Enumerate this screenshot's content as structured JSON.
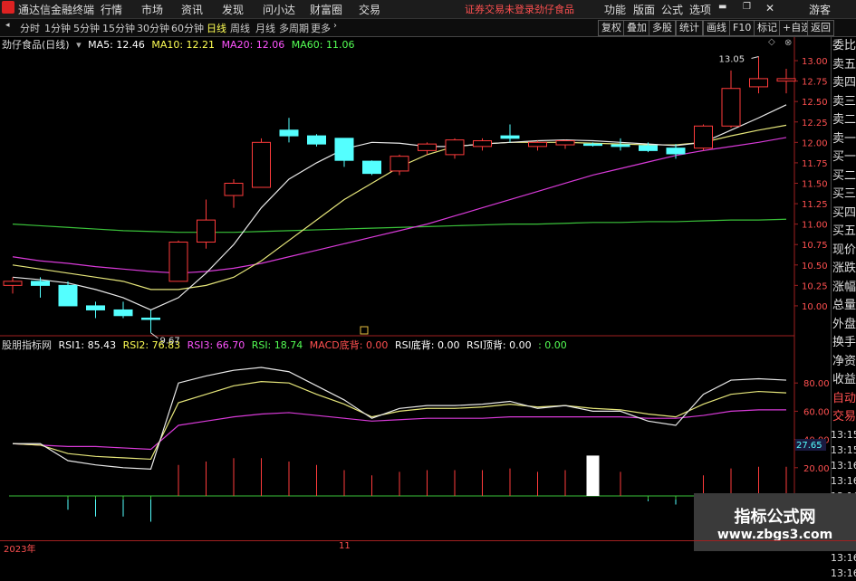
{
  "titlebar": {
    "app_title": "通达信金融终端",
    "menus": [
      "行情",
      "市场",
      "资讯",
      "发现",
      "问小达",
      "财富圈",
      "交易"
    ],
    "notice": "证券交易未登录",
    "stock": "劲仔食品",
    "right_menus": [
      "功能",
      "版面",
      "公式",
      "选项"
    ],
    "user": "游客"
  },
  "toolbar": {
    "periods": [
      "分时",
      "1分钟",
      "5分钟",
      "15分钟",
      "30分钟",
      "60分钟",
      "日线",
      "周线",
      "月线",
      "多周期",
      "更多"
    ],
    "active": "日线",
    "right_buttons": [
      "复权",
      "叠加",
      "多股",
      "统计",
      "画线",
      "F10",
      "标记",
      "+自选",
      "返回"
    ]
  },
  "main_chart": {
    "stock_title": "劲仔食品(日线)",
    "ma": [
      {
        "label": "MA5: 12.46",
        "color": "#ffffff"
      },
      {
        "label": "MA10: 12.21",
        "color": "#ffff54"
      },
      {
        "label": "MA20: 12.06",
        "color": "#ff54ff"
      },
      {
        "label": "MA60: 11.06",
        "color": "#54ff54"
      }
    ],
    "high_label": "13.05",
    "low_label": "9.67",
    "price_ticks": [
      "13.00",
      "12.75",
      "12.50",
      "12.25",
      "12.00",
      "11.75",
      "11.50",
      "11.25",
      "11.00",
      "10.75",
      "10.50",
      "10.25",
      "10.00"
    ]
  },
  "indicator": {
    "name": "股朋指标网",
    "items": [
      {
        "label": "RSI1: 85.43",
        "color": "#ffffff"
      },
      {
        "label": "RSI2: 76.83",
        "color": "#ffff54"
      },
      {
        "label": "RSI3: 66.70",
        "color": "#ff54ff"
      },
      {
        "label": "RSI: 18.74",
        "color": "#54ff54"
      },
      {
        "label": "MACD底背: 0.00",
        "color": "#ff5050"
      },
      {
        "label": "RSI底背: 0.00",
        "color": "#ffffff"
      },
      {
        "label": "RSI顶背: 0.00",
        "color": "#ffffff"
      },
      {
        "label": ": 0.00",
        "color": "#54ff54"
      }
    ],
    "ticks": [
      "80.00",
      "60.00",
      "40.00",
      "20.00"
    ],
    "current": "27.65"
  },
  "side_panel": [
    "委比",
    "卖五",
    "卖四",
    "卖三",
    "卖二",
    "卖一",
    "买一",
    "买二",
    "买三",
    "买四",
    "买五",
    "现价",
    "涨跌",
    "涨幅",
    "总量",
    "外盘",
    "换手",
    "净资",
    "收益"
  ],
  "side_lower": [
    "自动",
    "交易"
  ],
  "times": [
    "13:15",
    "13:15",
    "13:16",
    "13:16",
    "13:16",
    "13:16",
    "13:16",
    "13:16",
    "13:16",
    "13:16"
  ],
  "bottom": {
    "year": "2023年",
    "month": "11"
  },
  "watermark": {
    "title": "指标公式网",
    "url": "www.zbgs3.com"
  },
  "colors": {
    "up": "#ff3b3b",
    "down": "#54ffff",
    "bg": "#000000"
  },
  "chart_data": {
    "type": "candlestick",
    "ylim": [
      9.8,
      13.1
    ],
    "candles": [
      {
        "o": 10.25,
        "h": 10.35,
        "l": 10.15,
        "c": 10.3
      },
      {
        "o": 10.3,
        "h": 10.35,
        "l": 10.1,
        "c": 10.25
      },
      {
        "o": 10.25,
        "h": 10.3,
        "l": 10.0,
        "c": 10.0
      },
      {
        "o": 10.0,
        "h": 10.05,
        "l": 9.85,
        "c": 9.95
      },
      {
        "o": 9.95,
        "h": 10.05,
        "l": 9.85,
        "c": 9.88
      },
      {
        "o": 9.85,
        "h": 9.95,
        "l": 9.67,
        "c": 9.84
      },
      {
        "o": 10.3,
        "h": 10.8,
        "l": 10.3,
        "c": 10.78
      },
      {
        "o": 10.78,
        "h": 11.3,
        "l": 10.7,
        "c": 11.05
      },
      {
        "o": 11.35,
        "h": 11.55,
        "l": 11.2,
        "c": 11.5
      },
      {
        "o": 11.45,
        "h": 12.05,
        "l": 11.45,
        "c": 12.0
      },
      {
        "o": 12.15,
        "h": 12.3,
        "l": 12.0,
        "c": 12.08
      },
      {
        "o": 12.08,
        "h": 12.1,
        "l": 11.95,
        "c": 11.98
      },
      {
        "o": 12.05,
        "h": 12.05,
        "l": 11.7,
        "c": 11.78
      },
      {
        "o": 11.77,
        "h": 11.78,
        "l": 11.6,
        "c": 11.62
      },
      {
        "o": 11.65,
        "h": 11.85,
        "l": 11.6,
        "c": 11.83
      },
      {
        "o": 11.9,
        "h": 12.0,
        "l": 11.85,
        "c": 11.98
      },
      {
        "o": 11.85,
        "h": 12.05,
        "l": 11.8,
        "c": 12.03
      },
      {
        "o": 11.95,
        "h": 12.05,
        "l": 11.9,
        "c": 12.02
      },
      {
        "o": 12.08,
        "h": 12.22,
        "l": 12.0,
        "c": 12.05
      },
      {
        "o": 11.95,
        "h": 12.02,
        "l": 11.9,
        "c": 12.0
      },
      {
        "o": 11.97,
        "h": 12.03,
        "l": 11.92,
        "c": 12.02
      },
      {
        "o": 11.98,
        "h": 12.0,
        "l": 11.95,
        "c": 11.97
      },
      {
        "o": 11.97,
        "h": 12.05,
        "l": 11.9,
        "c": 11.95
      },
      {
        "o": 11.96,
        "h": 12.0,
        "l": 11.88,
        "c": 11.9
      },
      {
        "o": 11.93,
        "h": 11.98,
        "l": 11.8,
        "c": 11.86
      },
      {
        "o": 11.93,
        "h": 12.22,
        "l": 11.9,
        "c": 12.2
      },
      {
        "o": 12.2,
        "h": 12.88,
        "l": 12.18,
        "c": 12.66
      },
      {
        "o": 12.68,
        "h": 13.05,
        "l": 12.6,
        "c": 12.78
      },
      {
        "o": 12.75,
        "h": 12.9,
        "l": 12.6,
        "c": 12.78
      }
    ],
    "ma5": [
      10.35,
      10.32,
      10.28,
      10.2,
      10.1,
      9.95,
      10.1,
      10.4,
      10.75,
      11.2,
      11.55,
      11.75,
      11.92,
      12.0,
      11.99,
      11.95,
      11.95,
      11.98,
      12.0,
      12.02,
      12.03,
      12.02,
      12.0,
      11.98,
      11.96,
      12.0,
      12.15,
      12.3,
      12.46
    ],
    "ma10": [
      10.5,
      10.45,
      10.4,
      10.35,
      10.3,
      10.2,
      10.2,
      10.25,
      10.35,
      10.55,
      10.8,
      11.05,
      11.3,
      11.5,
      11.7,
      11.85,
      11.95,
      11.98,
      12.0,
      12.0,
      12.0,
      11.99,
      11.98,
      11.97,
      11.97,
      12.0,
      12.08,
      12.15,
      12.21
    ],
    "ma20": [
      10.6,
      10.55,
      10.52,
      10.48,
      10.45,
      10.42,
      10.4,
      10.42,
      10.46,
      10.52,
      10.6,
      10.68,
      10.76,
      10.84,
      10.92,
      11.0,
      11.1,
      11.2,
      11.3,
      11.4,
      11.5,
      11.6,
      11.68,
      11.76,
      11.84,
      11.9,
      11.95,
      12.0,
      12.06
    ],
    "ma60": [
      11.0,
      10.98,
      10.96,
      10.94,
      10.92,
      10.91,
      10.9,
      10.9,
      10.9,
      10.91,
      10.92,
      10.93,
      10.94,
      10.95,
      10.96,
      10.97,
      10.98,
      10.99,
      11.0,
      11.0,
      11.01,
      11.02,
      11.02,
      11.03,
      11.03,
      11.04,
      11.05,
      11.05,
      11.06
    ],
    "rsi_ylim": [
      0,
      100
    ],
    "rsi1": [
      37,
      37,
      25,
      22,
      20,
      19,
      80,
      85,
      89,
      91,
      88,
      78,
      68,
      55,
      62,
      64,
      64,
      65,
      67,
      62,
      64,
      60,
      60,
      53,
      50,
      72,
      82,
      83,
      82
    ],
    "rsi2": [
      37,
      36,
      30,
      28,
      27,
      26,
      66,
      72,
      78,
      81,
      80,
      72,
      65,
      56,
      60,
      62,
      62,
      63,
      65,
      63,
      64,
      62,
      61,
      58,
      56,
      65,
      72,
      74,
      73
    ],
    "rsi3": [
      37,
      36,
      35,
      35,
      34,
      33,
      50,
      53,
      56,
      58,
      59,
      57,
      55,
      53,
      54,
      55,
      55,
      55,
      56,
      56,
      56,
      56,
      56,
      55,
      55,
      57,
      60,
      61,
      61
    ],
    "histogram": [
      0,
      0,
      -8,
      -12,
      -12,
      -15,
      18,
      20,
      22,
      22,
      20,
      18,
      15,
      12,
      14,
      15,
      15,
      15,
      16,
      14,
      15,
      14,
      14,
      -3,
      -5,
      12,
      16,
      17,
      17
    ],
    "highlight_bar_index": 21
  }
}
